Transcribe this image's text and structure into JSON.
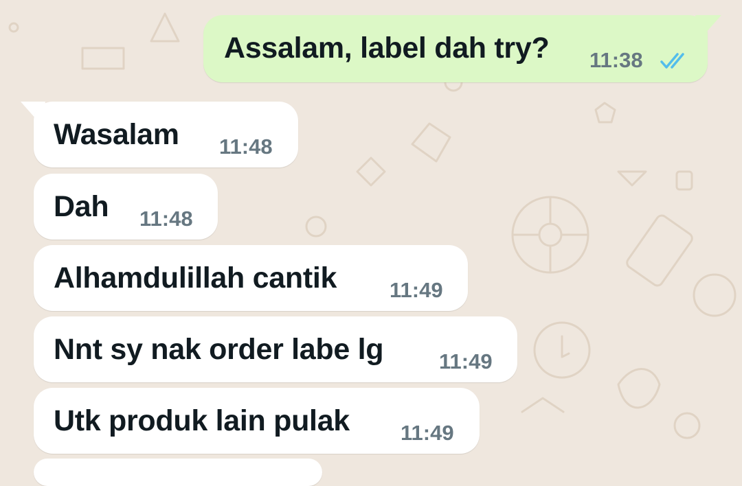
{
  "chat": {
    "messages": [
      {
        "direction": "outgoing",
        "text": "Assalam, label dah try?",
        "time": "11:38",
        "status": "read-double-check-icon"
      },
      {
        "direction": "incoming",
        "text": "Wasalam",
        "time": "11:48"
      },
      {
        "direction": "incoming",
        "text": "Dah",
        "time": "11:48"
      },
      {
        "direction": "incoming",
        "text": "Alhamdulillah cantik",
        "time": "11:49"
      },
      {
        "direction": "incoming",
        "text": "Nnt sy nak order labe lg",
        "time": "11:49"
      },
      {
        "direction": "incoming",
        "text": "Utk produk lain pulak",
        "time": "11:49"
      }
    ]
  },
  "colors": {
    "background": "#efe7de",
    "incoming_bubble": "#ffffff",
    "outgoing_bubble": "#dcf8c6",
    "read_ticks": "#53bdeb",
    "time_text": "#667781"
  }
}
